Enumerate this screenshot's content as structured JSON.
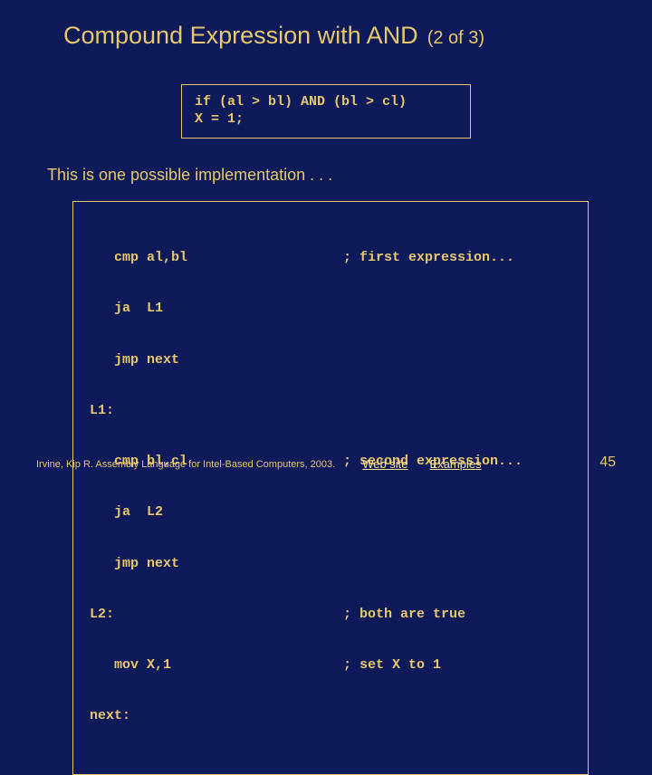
{
  "title": "Compound Expression with AND",
  "subtitle": "(2 of 3)",
  "pseudo": {
    "line1": "if (al > bl) AND (bl > cl)",
    "line2": "  X = 1;"
  },
  "caption": "This is one possible implementation . . .",
  "code": [
    {
      "left": "   cmp al,bl",
      "right": "; first expression..."
    },
    {
      "left": "   ja  L1",
      "right": ""
    },
    {
      "left": "   jmp next",
      "right": ""
    },
    {
      "left": "L1:",
      "right": ""
    },
    {
      "left": "   cmp bl,cl",
      "right": "; second expression..."
    },
    {
      "left": "   ja  L2",
      "right": ""
    },
    {
      "left": "   jmp next",
      "right": ""
    },
    {
      "left": "L2:",
      "right": "; both are true"
    },
    {
      "left": "   mov X,1",
      "right": "; set X to 1"
    },
    {
      "left": "next:",
      "right": ""
    }
  ],
  "footer": {
    "citation": "Irvine, Kip R. Assembly Language for Intel-Based Computers, 2003.",
    "link1": "Web site",
    "link2": "Examples"
  },
  "page": "45"
}
